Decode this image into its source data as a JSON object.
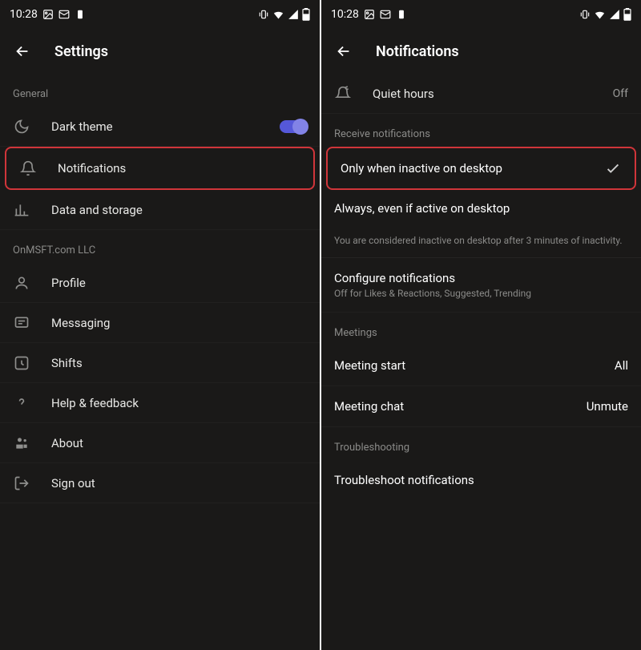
{
  "status": {
    "time": "10:28",
    "icons_left": [
      "image-icon",
      "mail-icon",
      "note-icon"
    ],
    "icons_right": [
      "vibrate-icon",
      "wifi-icon",
      "signal-icon",
      "battery-icon"
    ]
  },
  "left": {
    "title": "Settings",
    "section_general": "General",
    "items": {
      "dark_theme": "Dark theme",
      "notifications": "Notifications",
      "data_storage": "Data and storage"
    },
    "section_org": "OnMSFT.com LLC",
    "org_items": {
      "profile": "Profile",
      "messaging": "Messaging",
      "shifts": "Shifts",
      "help": "Help & feedback",
      "about": "About",
      "signout": "Sign out"
    }
  },
  "right": {
    "title": "Notifications",
    "quiet_hours": {
      "label": "Quiet hours",
      "value": "Off"
    },
    "section_receive": "Receive notifications",
    "opt_inactive": "Only when inactive on desktop",
    "opt_always": "Always, even if active on desktop",
    "helper": "You are considered inactive on desktop after 3 minutes of inactivity.",
    "configure": {
      "label": "Configure notifications",
      "sub": "Off for Likes & Reactions, Suggested, Trending"
    },
    "section_meetings": "Meetings",
    "meeting_start": {
      "label": "Meeting start",
      "value": "All"
    },
    "meeting_chat": {
      "label": "Meeting chat",
      "value": "Unmute"
    },
    "section_trouble": "Troubleshooting",
    "troubleshoot": "Troubleshoot notifications"
  }
}
